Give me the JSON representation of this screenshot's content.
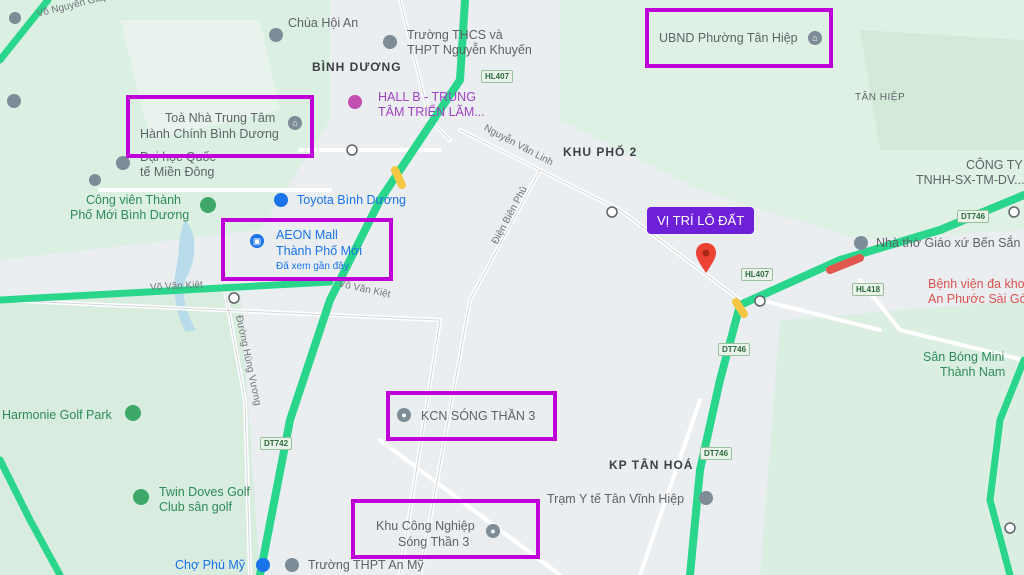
{
  "map": {
    "areas": {
      "binh_duong": "BÌNH DƯƠNG",
      "khu_pho_2": "KHU PHỐ 2",
      "kp_tan_hoa": "KP TÂN HOÁ",
      "tan_hiep": "TÂN HIỆP"
    },
    "streets": {
      "vo_nguyen_giap": "Võ Nguyên Giáp",
      "nguyen_van_linh": "Nguyễn Văn Linh",
      "dien_bien_phu": "Điện Biên Phủ",
      "vo_van_kiet_left": "Võ Văn Kiệt",
      "vo_van_kiet_right": "Võ Văn Kiệt",
      "duong_hung_vuong": "Đường Hùng Vương"
    },
    "route_badges": [
      "HL407",
      "HL407",
      "DT746",
      "DT746",
      "DT746",
      "HL418",
      "DT742"
    ],
    "pois": {
      "chua_hoi_an": "Chùa Hội An",
      "truong_thcs_1": "Trường THCS và",
      "truong_thcs_2": "THPT Nguyễn Khuyến",
      "hall_b_1": "HALL B - TRUNG",
      "hall_b_2": "TÂM TRIỂN LÃM...",
      "dai_hoc_1": "Đại học Quốc",
      "dai_hoc_2": "tế Miền Đông",
      "cong_vien_1": "Công viên Thành",
      "cong_vien_2": "Phố Mới Bình Dương",
      "toyota": "Toyota Bình Dương",
      "harmonie": "Harmonie Golf Park",
      "twin_1": "Twin Doves Golf",
      "twin_2": "Club sân golf",
      "cho_phu_my": "Chợ Phú Mỹ",
      "thpt_an_my": "Trường THPT An Mỹ",
      "tram_y_te": "Trạm Y tế Tân Vĩnh Hiệp",
      "nha_tho": "Nhà thờ Giáo xứ Bến Sắn",
      "benh_vien_1": "Bệnh viện đa khoa",
      "benh_vien_2": "An Phước Sài Gòn",
      "cong_ty_1": "CÔNG TY",
      "cong_ty_2": "TNHH-SX-TM-DV...",
      "san_bong_1": "Sân Bóng Mini",
      "san_bong_2": "Thành Nam"
    },
    "highlights": {
      "ubnd": "UBND Phường Tân Hiệp",
      "toa_nha_1": "Toà Nhà Trung Tâm",
      "toa_nha_2": "Hành Chính Bình Dương",
      "aeon_1": "AEON Mall",
      "aeon_2": "Thành Phố Mới",
      "aeon_3": "Đã xem gần đây",
      "kcn_st3": "KCN SÓNG THẦN 3",
      "khu_cn_1": "Khu Công Nghiệp",
      "khu_cn_2": "Sóng Thần 3"
    },
    "marker_label": "VỊ TRÍ LÔ ĐẤT",
    "colors": {
      "highlight_border": "#c000d8",
      "callout": "#6e1fd8",
      "highway": "#2ee39a",
      "marker": "#ea4335"
    }
  }
}
